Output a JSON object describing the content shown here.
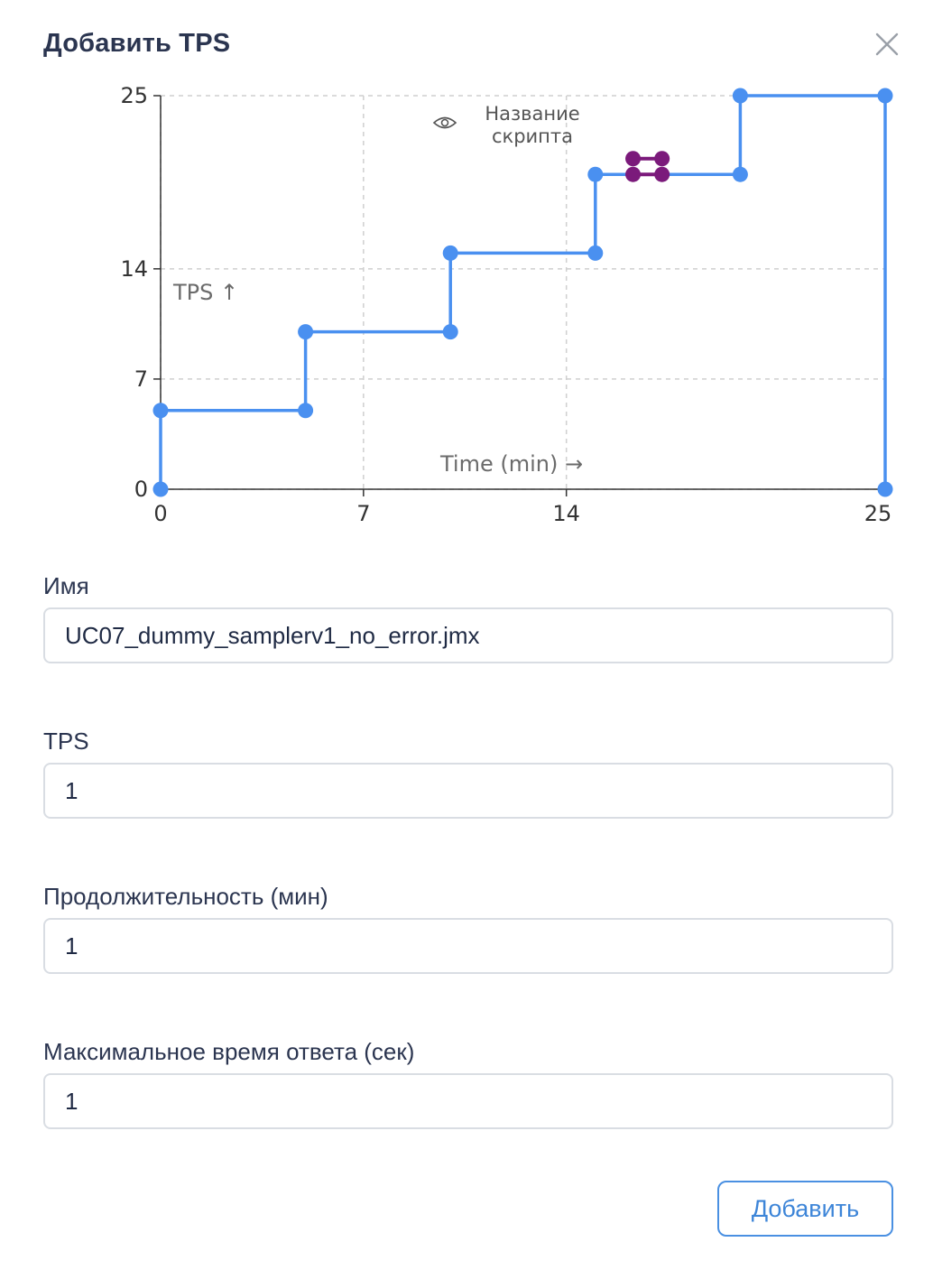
{
  "modal": {
    "title": "Добавить TPS"
  },
  "chart_data": {
    "type": "line",
    "step": true,
    "xlabel": "Time (min) →",
    "ylabel": "TPS ↑",
    "xlim": [
      0,
      25
    ],
    "ylim": [
      0,
      25
    ],
    "x_ticks": [
      "0",
      "7",
      "14",
      "25"
    ],
    "y_ticks": [
      "0",
      "7",
      "14",
      "25"
    ],
    "grid": true,
    "legend": {
      "label_line1": "Название",
      "label_line2": "скрипта",
      "icon": "eye-icon",
      "placement": "top-center"
    },
    "series": [
      {
        "color": "#4a90f0",
        "points": [
          [
            0,
            0
          ],
          [
            0,
            5
          ],
          [
            5,
            5
          ],
          [
            5,
            10
          ],
          [
            10,
            10
          ],
          [
            10,
            15
          ],
          [
            15,
            15
          ],
          [
            15,
            20
          ],
          [
            20,
            20
          ],
          [
            20,
            25
          ],
          [
            25,
            25
          ],
          [
            25,
            0
          ]
        ]
      }
    ],
    "marker": {
      "color": "#7b1a7b",
      "points": [
        [
          16.3,
          21
        ],
        [
          17.3,
          21
        ],
        [
          16.3,
          20
        ],
        [
          17.3,
          20
        ]
      ]
    }
  },
  "form": {
    "name": {
      "label": "Имя",
      "value": "UC07_dummy_samplerv1_no_error.jmx"
    },
    "tps": {
      "label": "TPS",
      "value": "1"
    },
    "duration": {
      "label": "Продолжительность (мин)",
      "value": "1"
    },
    "max_response": {
      "label": "Максимальное время ответа (сек)",
      "value": "1"
    },
    "submit_label": "Добавить"
  },
  "colors": {
    "accent": "#4a90e2",
    "line": "#4a90f0",
    "marker": "#7b1a7b"
  }
}
